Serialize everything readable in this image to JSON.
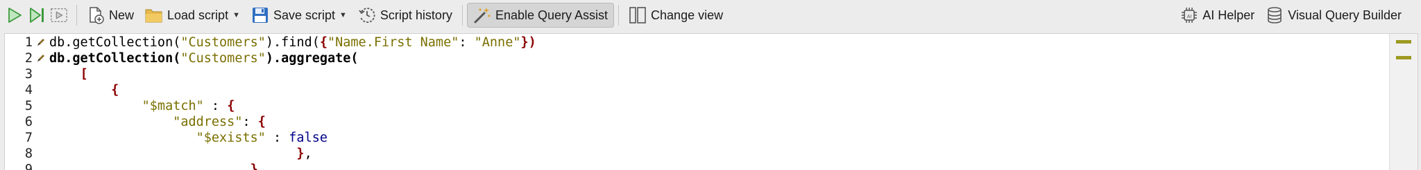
{
  "toolbar": {
    "new_label": "New",
    "load_label": "Load script",
    "save_label": "Save script",
    "history_label": "Script history",
    "query_assist_label": "Enable Query Assist",
    "change_view_label": "Change view",
    "ai_helper_label": "AI Helper",
    "vqb_label": "Visual Query Builder"
  },
  "editor": {
    "lines": [
      {
        "n": "1",
        "tokens": [
          [
            "plain",
            "db.getCollection("
          ],
          [
            "str",
            "\"Customers\""
          ],
          [
            "plain",
            ").find("
          ],
          [
            "brace",
            "{"
          ],
          [
            "str",
            "\"Name.First Name\""
          ],
          [
            "plain",
            ": "
          ],
          [
            "str",
            "\"Anne\""
          ],
          [
            "brace",
            "})"
          ]
        ]
      },
      {
        "n": "2",
        "tokens": [
          [
            "bold",
            "db.getCollection("
          ],
          [
            "str",
            "\"Customers\""
          ],
          [
            "bold",
            ").aggregate("
          ]
        ]
      },
      {
        "n": "3",
        "tokens": [
          [
            "plain",
            "    "
          ],
          [
            "brace",
            "["
          ]
        ]
      },
      {
        "n": "4",
        "tokens": [
          [
            "plain",
            "        "
          ],
          [
            "brace",
            "{"
          ]
        ]
      },
      {
        "n": "5",
        "tokens": [
          [
            "plain",
            "            "
          ],
          [
            "str",
            "\"$match\""
          ],
          [
            "plain",
            " : "
          ],
          [
            "brace",
            "{"
          ]
        ]
      },
      {
        "n": "6",
        "tokens": [
          [
            "plain",
            "                "
          ],
          [
            "str",
            "\"address\""
          ],
          [
            "plain",
            ": "
          ],
          [
            "brace",
            "{"
          ]
        ]
      },
      {
        "n": "7",
        "tokens": [
          [
            "plain",
            "                   "
          ],
          [
            "str",
            "\"$exists\""
          ],
          [
            "plain",
            " : "
          ],
          [
            "kw",
            "false"
          ]
        ]
      },
      {
        "n": "8",
        "tokens": [
          [
            "plain",
            "                                "
          ],
          [
            "brace",
            "}"
          ],
          [
            "plain",
            ","
          ]
        ]
      },
      {
        "n": "9",
        "tokens": [
          [
            "plain",
            "                          "
          ],
          [
            "brace",
            "}"
          ]
        ]
      }
    ]
  }
}
